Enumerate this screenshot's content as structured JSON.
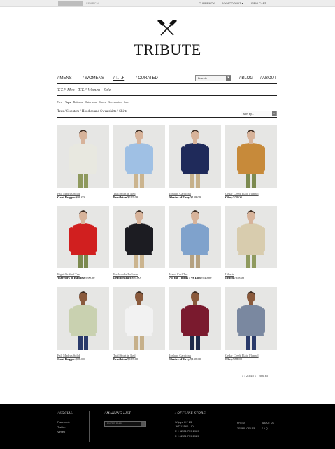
{
  "topbar": {
    "search_label": "SEARCH",
    "links": [
      "CURRENCY",
      "MY ACCOUNT ▾",
      "VIEW CART"
    ]
  },
  "logo": {
    "text": "TRIBUTE"
  },
  "nav": {
    "items": [
      "/ MENS",
      "/ WOMENS",
      "/ T.T.F",
      "/ CURATED",
      "/ BLOG",
      "/ ABOUT"
    ],
    "active": "/ T.T.F",
    "brands_select": "Brands"
  },
  "breadcrumb": {
    "part1": "T.T.F Men",
    "rest": " - T.T.F Women - Sale"
  },
  "filters": {
    "items": [
      "New",
      "Tops",
      "Bottoms",
      "Outerwear",
      "Shoes",
      "Accessories",
      "Sale"
    ],
    "selected": "Tops"
  },
  "categories": "Tees / Sweaters / Hoodies and Sweatshirts / Shirts",
  "sort": {
    "label": "sort by..."
  },
  "products": [
    {
      "name": "Fall Madras Solid",
      "brand": "Gant Rugger",
      "price": "/$98.00",
      "shirt": "#e8e8e0",
      "pants": "#8f9a5e",
      "skin": "#d7b39a"
    },
    {
      "name": "Trail Shirt in Red",
      "brand": "Pendleton",
      "price": "/$105.00",
      "shirt": "#9fc0e4",
      "pants": "#cbb48e",
      "skin": "#d7b39a"
    },
    {
      "name": "Iceland Cardigan",
      "brand": "Shades of Grey",
      "price": "/$158.00",
      "shirt": "#1f2a5a",
      "pants": "#c6b08a",
      "skin": "#d7b39a"
    },
    {
      "name": "Cedar Creek Plaid Flannel",
      "brand": "Obey",
      "price": "/$78.00",
      "shirt": "#c78a3a",
      "pants": "#7c8a4f",
      "skin": "#d7b39a"
    },
    {
      "name": "Fight Or Surf Tee",
      "brand": "Warriors of Radness",
      "price": "/$90.00",
      "shirt": "#d11f1f",
      "pants": "#7c8a4f",
      "skin": "#d7b39a"
    },
    {
      "name": "Backcorde Pullover",
      "brand": "Leatherkraft",
      "price": "/$95.00",
      "shirt": "#1c1c22",
      "pants": "#cbb48e",
      "skin": "#d7b39a"
    },
    {
      "name": "Hand Curl Tee",
      "brand": "All the Things I've Done",
      "price": "/$40.00",
      "shirt": "#7fa2cc",
      "pants": "#b5a180",
      "skin": "#d7b39a"
    },
    {
      "name": "Liberte",
      "brand": "Insight",
      "price": "/$58.00",
      "shirt": "#d8ccae",
      "pants": "#8f9a5e",
      "skin": "#d7b39a"
    },
    {
      "name": "Fall Madras Solid",
      "brand": "Gant Rugger",
      "price": "/$98.00",
      "shirt": "#c9d1b0",
      "pants": "#2a3a6a",
      "skin": "#8a5a3c"
    },
    {
      "name": "Trail Shirt in Red",
      "brand": "Pendleton",
      "price": "/$105.00",
      "shirt": "#f2f2f2",
      "pants": "#c6b08a",
      "skin": "#8a5a3c"
    },
    {
      "name": "Iceland Cardigan",
      "brand": "Shades of Grey",
      "price": "/$158.00",
      "shirt": "#7a1a2e",
      "pants": "#1e2a4a",
      "skin": "#8a5a3c"
    },
    {
      "name": "Cedar Creek Plaid Flannel",
      "brand": "Obey",
      "price": "/$78.00",
      "shirt": "#7a88a0",
      "pants": "#2a3a6a",
      "skin": "#8a5a3c"
    }
  ],
  "pagination": {
    "prev": "« ",
    "pages": "1 2 3 4 5",
    "next": " »",
    "view_all": "view all"
  },
  "footer": {
    "social_title": "/ SOCIAL",
    "social_links": [
      "Facebook",
      "Twitter",
      "Vimeo"
    ],
    "mailing_title": "/ MAILING LIST",
    "mailing_placeholder": "ENTER EMAIL",
    "store_title": "/ OFFLINE STORE",
    "store_lines": [
      "Wijaya III / 23",
      "JKT 12160 - ID",
      "P. +62 21 739 2929",
      "F. +62 21 739 2929"
    ],
    "info_links": [
      "PRESS",
      "ABOUT US",
      "TERMS OF USE",
      "F.A.Q."
    ]
  }
}
